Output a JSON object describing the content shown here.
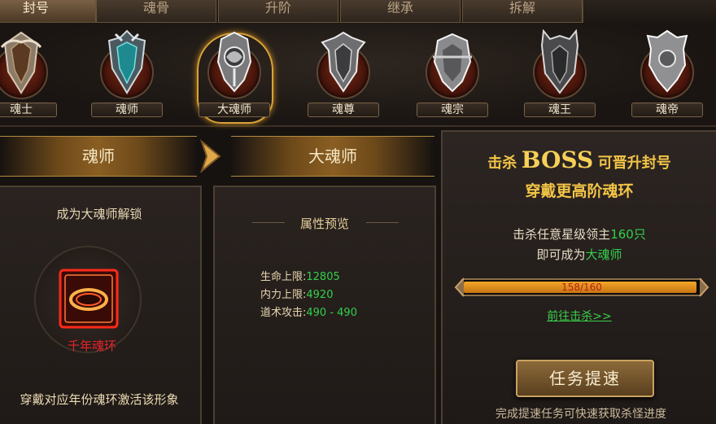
{
  "tabs": [
    {
      "label": "封号",
      "active": true
    },
    {
      "label": "魂骨",
      "active": false
    },
    {
      "label": "升阶",
      "active": false
    },
    {
      "label": "继承",
      "active": false
    },
    {
      "label": "拆解",
      "active": false
    }
  ],
  "ranks": [
    {
      "label": "魂士"
    },
    {
      "label": "魂师"
    },
    {
      "label": "大魂师",
      "selected": true
    },
    {
      "label": "魂尊"
    },
    {
      "label": "魂宗"
    },
    {
      "label": "魂王"
    },
    {
      "label": "魂帝"
    }
  ],
  "left_panel": {
    "header": "魂师",
    "unlock_text": "成为大魂师解锁",
    "ring_label": "千年魂环",
    "bottom_text": "穿戴对应年份魂环激活该形象"
  },
  "middle_panel": {
    "header": "大魂师",
    "section_title": "属性预览",
    "stats": [
      {
        "label": "生命上限:",
        "value": "12805"
      },
      {
        "label": "内力上限:",
        "value": "4920"
      },
      {
        "label": "道术攻击:",
        "value": "490 - 490"
      }
    ]
  },
  "right_panel": {
    "title_prefix": "击杀",
    "title_boss": "BOSS",
    "title_suffix": "可晋升封号",
    "subtitle": "穿戴更高阶魂环",
    "kill_text": "击杀任意星级领主",
    "kill_count": "160只",
    "become_text": "即可成为",
    "become_rank": "大魂师",
    "progress_text": "158/160",
    "progress_fraction": 0.9875,
    "goto_link": "前往击杀>>",
    "speed_button": "任务提速",
    "footer_text": "完成提速任务可快速获取杀怪进度"
  },
  "colors": {
    "gold": "#f0c04a",
    "green": "#32d04a",
    "progress_fill": "#f2a62a",
    "ring_red": "#ff2a1a"
  }
}
